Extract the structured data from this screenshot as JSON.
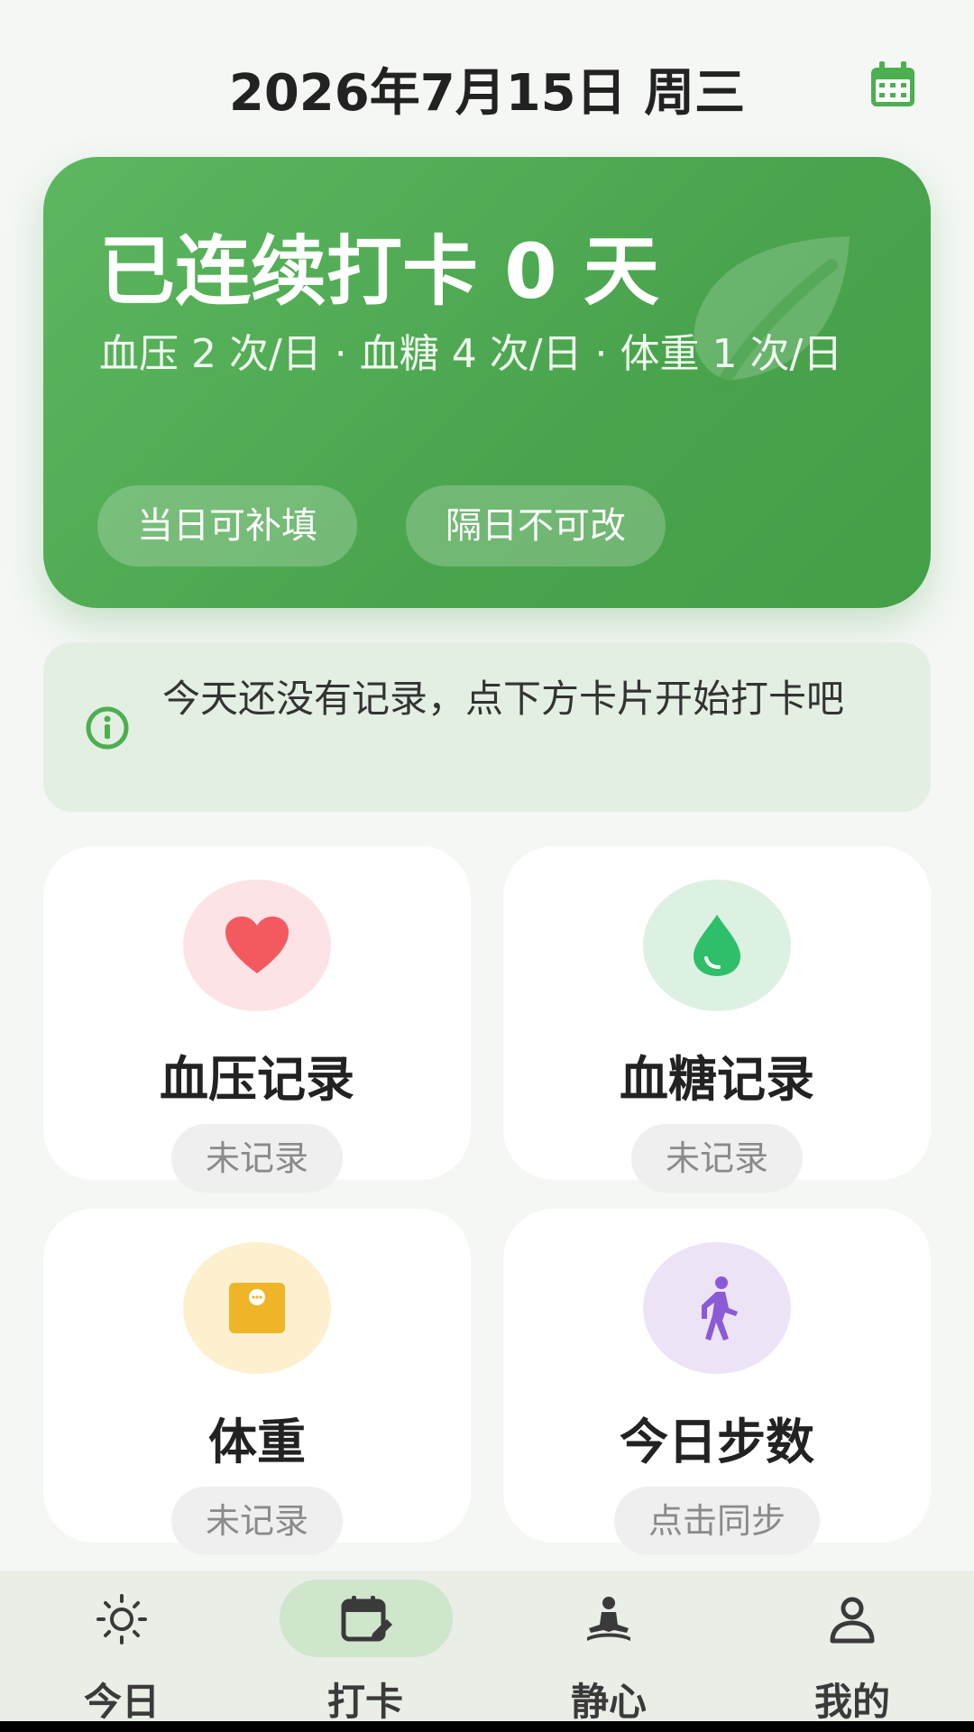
{
  "header": {
    "date_title": "2026年7月15日 周三"
  },
  "hero": {
    "title": "已连续打卡 0 天",
    "subtitle": "血压 2 次/日 · 血糖 4 次/日 · 体重 1 次/日",
    "pills": [
      "当日可补填",
      "隔日不可改"
    ]
  },
  "notice": {
    "text": "今天还没有记录，点下方卡片开始打卡吧"
  },
  "cards": [
    {
      "title": "血压记录",
      "status": "未记录",
      "icon": "heart-icon",
      "circle_color": "#fde3e6",
      "icon_color": "#f25a5f"
    },
    {
      "title": "血糖记录",
      "status": "未记录",
      "icon": "drop-icon",
      "circle_color": "#dcf1e2",
      "icon_color": "#2fbf6a"
    },
    {
      "title": "体重",
      "status": "未记录",
      "icon": "scale-icon",
      "circle_color": "#fdf0cf",
      "icon_color": "#f0b429"
    },
    {
      "title": "今日步数",
      "status": "点击同步",
      "icon": "walking-icon",
      "circle_color": "#ece3f7",
      "icon_color": "#8b5ad6"
    }
  ],
  "nav": {
    "items": [
      {
        "label": "今日",
        "icon": "sun-icon"
      },
      {
        "label": "打卡",
        "icon": "calendar-edit-icon",
        "active": true
      },
      {
        "label": "静心",
        "icon": "meditation-icon"
      },
      {
        "label": "我的",
        "icon": "person-icon"
      }
    ]
  },
  "colors": {
    "brand_green": "#4caf50",
    "accent_green": "#5db760"
  }
}
